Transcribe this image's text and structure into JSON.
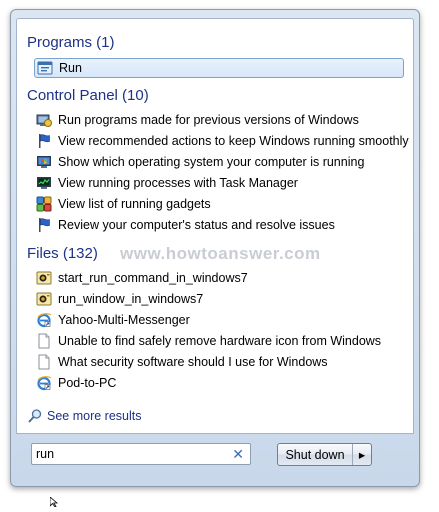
{
  "programs": {
    "header": "Programs (1)",
    "items": [
      {
        "label": "Run",
        "icon": "run-icon"
      }
    ]
  },
  "control_panel": {
    "header": "Control Panel (10)",
    "items": [
      {
        "label": "Run programs made for previous versions of Windows",
        "icon": "compatibility-icon"
      },
      {
        "label": "View recommended actions to keep Windows running smoothly",
        "icon": "action-center-flag-icon"
      },
      {
        "label": "Show which operating system your computer is running",
        "icon": "system-icon"
      },
      {
        "label": "View running processes with Task Manager",
        "icon": "task-manager-icon"
      },
      {
        "label": "View list of running gadgets",
        "icon": "gadgets-icon"
      },
      {
        "label": "Review your computer's status and resolve issues",
        "icon": "action-center-flag-icon"
      }
    ]
  },
  "files": {
    "header": "Files (132)",
    "items": [
      {
        "label": "start_run_command_in_windows7",
        "icon": "image-file-icon"
      },
      {
        "label": "run_window_in_windows7",
        "icon": "image-file-icon"
      },
      {
        "label": "Yahoo-Multi-Messenger",
        "icon": "ie-shortcut-icon"
      },
      {
        "label": "Unable to find safely remove hardware icon from Windows",
        "icon": "document-icon"
      },
      {
        "label": "What security software should I use for Windows",
        "icon": "document-icon"
      },
      {
        "label": "Pod-to-PC",
        "icon": "ie-shortcut-icon"
      }
    ]
  },
  "watermark": "www.howtoanswer.com",
  "see_more": "See more results",
  "search": {
    "value": "run",
    "clear_glyph": "✕"
  },
  "shutdown": {
    "label": "Shut down",
    "arrow_glyph": "▸"
  },
  "colors": {
    "header_blue": "#1e3287",
    "selection_border": "#7da2ce"
  }
}
